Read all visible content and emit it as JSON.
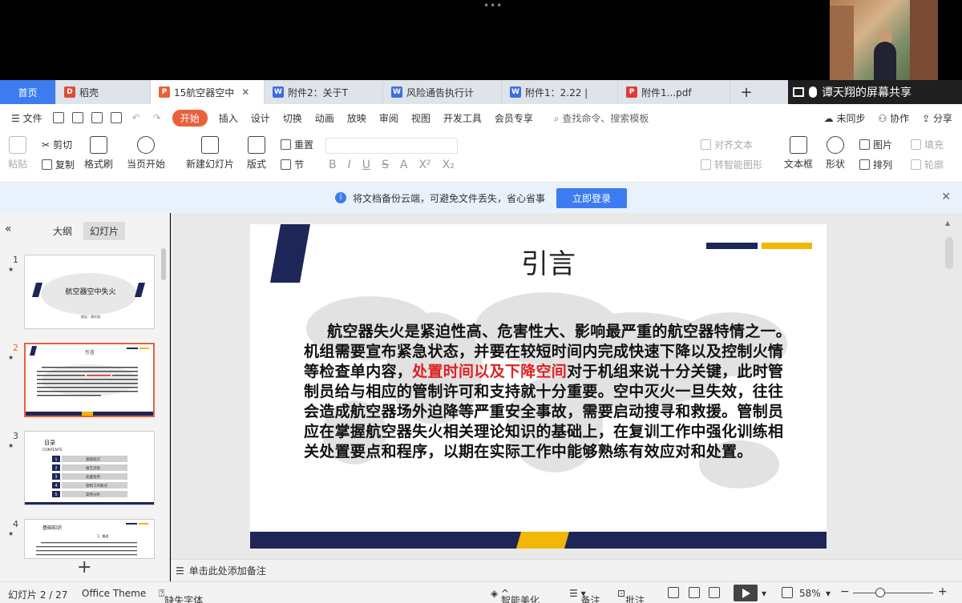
{
  "top": {
    "dots": "•••"
  },
  "tabs": [
    {
      "label": "首页",
      "icon": "home"
    },
    {
      "label": "稻壳",
      "icon": "docer-icon"
    },
    {
      "label": "15航空器空中",
      "icon": "ppt-icon"
    },
    {
      "label": "附件2：关于T",
      "icon": "word-icon"
    },
    {
      "label": "风险通告执行计",
      "icon": "word-icon"
    },
    {
      "label": "附件1：2.22 |",
      "icon": "word-icon"
    },
    {
      "label": "附件1...pdf",
      "icon": "pdf-icon"
    }
  ],
  "share": {
    "text": "谭天翔的屏幕共享"
  },
  "menu": {
    "file": "文件",
    "items": [
      "开始",
      "插入",
      "设计",
      "切换",
      "动画",
      "放映",
      "审阅",
      "视图",
      "开发工具",
      "会员专享"
    ],
    "search": "查找命令、搜索模板",
    "sync": "未同步",
    "collab": "协作",
    "share": "分享"
  },
  "ribbon": {
    "paste": "粘贴",
    "cut": "剪切",
    "copy": "复制",
    "format_painter": "格式刷",
    "from_current": "当页开始",
    "new_slide": "新建幻灯片",
    "layout": "版式",
    "reset": "重置",
    "section": "节",
    "align_text": "对齐文本",
    "smart_shape": "转智能图形",
    "textbox": "文本框",
    "shape": "形状",
    "picture": "图片",
    "arrange": "排列",
    "fill": "填充",
    "outline": "轮廓"
  },
  "notification": {
    "text": "将文档备份云端，可避免文件丢失，省心省事",
    "button": "立即登录"
  },
  "leftpanel": {
    "tab_outline": "大纲",
    "tab_slides": "幻灯片",
    "thumbs": [
      {
        "num": "1",
        "title": "航空器空中失火",
        "sub": "报告：谭天翔"
      },
      {
        "num": "2",
        "title": "引言"
      },
      {
        "num": "3",
        "title": "目录",
        "sub": "CONTENTS",
        "items": [
          "基础知识",
          "报告流程",
          "处置程序",
          "管制工作要点",
          "案例分析"
        ]
      },
      {
        "num": "4",
        "title": "基础知识",
        "sub": "1、概述"
      }
    ]
  },
  "slide": {
    "title": "引言",
    "body_pre": "航空器失火是紧迫性高、危害性大、影响最严重的航空器特情之一。机组需要宣布紧急状态，并要在较短时间内完成快速下降以及控制火情等检查单内容，",
    "body_red": "处置时间以及下降空间",
    "body_post": "对于机组来说十分关键，此时管制员给与相应的管制许可和支持就十分重要。空中灭火一旦失效，往往会造成航空器场外迫降等严重安全事故，需要启动搜寻和救援。管制员应在掌握航空器失火相关理论知识的基础上，在复训工作中强化训练相关处置要点和程序，以期在实际工作中能够熟练有效应对和处置。",
    "colors": {
      "navy": "#1e2557",
      "gold": "#f2b705",
      "red": "#e02020"
    }
  },
  "notes": {
    "placeholder": "单击此处添加备注"
  },
  "status": {
    "slide_info": "幻灯片 2 / 27",
    "theme": "Office Theme",
    "missing_font": "缺失字体",
    "beautify": "智能美化",
    "notes": "备注",
    "comments": "批注",
    "zoom": "58%"
  }
}
